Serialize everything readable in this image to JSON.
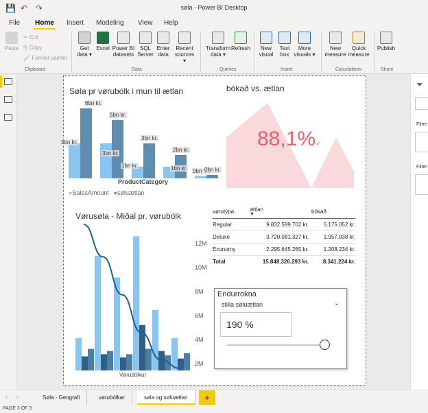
{
  "app": {
    "title": "søla - Power BI Desktop"
  },
  "ribbon_tabs": [
    "File",
    "Home",
    "Insert",
    "Modeling",
    "View",
    "Help"
  ],
  "active_tab": "Home",
  "ribbon": {
    "clipboard": {
      "paste": "Paste",
      "cut": "Cut",
      "copy": "Copy",
      "format_painter": "Format painter",
      "group": "Clipboard"
    },
    "data": {
      "get_data": "Get data ▾",
      "excel": "Excel",
      "pbi_datasets": "Power BI datasets",
      "sql": "SQL Server",
      "enter": "Enter data",
      "recent": "Recent sources ▾",
      "group": "Data"
    },
    "queries": {
      "transform": "Transform data ▾",
      "refresh": "Refresh",
      "group": "Queries"
    },
    "insert": {
      "new_visual": "New visual",
      "text_box": "Text box",
      "more_visuals": "More visuals ▾",
      "group": "Insert"
    },
    "calculations": {
      "new_measure": "New measure",
      "quick_measure": "Quick measure",
      "group": "Calculations"
    },
    "share": {
      "publish": "Publish",
      "group": "Share"
    }
  },
  "visual1": {
    "title": "Søla pr vørubólk i mun til ætlan",
    "xlabel": "ProductCategory",
    "legend": [
      "SalesAmount",
      "søluætlan"
    ],
    "labels": [
      "6bn kr.",
      "3bn kr.",
      "5bn kr.",
      "3bn kr.",
      "3bn kr.",
      "1bn kr.",
      "1bn kr.",
      "2bn kr.",
      "0bn kr.",
      "0bn kr."
    ]
  },
  "visual2": {
    "title": "bókað vs. ætlan",
    "value": "88,1%"
  },
  "visual3": {
    "title": "Vørusøla - Miðal pr. vørubólk",
    "xlabel": "Vørubólkur",
    "yticks": [
      "12M",
      "10M",
      "8M",
      "6M",
      "4M",
      "2M"
    ]
  },
  "matrix": {
    "headers": [
      "vørutýpa",
      "ætlan",
      "bókað"
    ],
    "rows": [
      [
        "Regular",
        "9.832.599.702 kr.",
        "5.175.052 kr."
      ],
      [
        "Deluxe",
        "3.720.081.327 kr.",
        "1.957.938 kr."
      ],
      [
        "Economy",
        "2.295.645.265 kr.",
        "1.208.234 kr."
      ]
    ],
    "total": [
      "Total",
      "15.848.326.293 kr.",
      "8.341.224 kr."
    ]
  },
  "slicer": {
    "title": "Endurrokna",
    "field": "stilla søluætlan",
    "value": "190 %"
  },
  "right_panel": {
    "filter_label_1": "Filter",
    "filter_label_2": "Filter"
  },
  "page_tabs": [
    "Søla - Geografi",
    "vørubólkar",
    "søla og søluætlan"
  ],
  "active_page": "søla og søluætlan",
  "status": "PAGE 3 OF 3",
  "chart_data": [
    {
      "type": "bar",
      "title": "Søla pr vørubólk i mun til ætlan",
      "xlabel": "ProductCategory",
      "series": [
        {
          "name": "SalesAmount",
          "values": [
            3,
            3,
            1,
            1,
            0.2
          ]
        },
        {
          "name": "søluætlan",
          "values": [
            6,
            5,
            3,
            2,
            0.3
          ]
        }
      ],
      "colors": [
        "#8cc4f0",
        "#5f8db0"
      ]
    },
    {
      "type": "bar",
      "title": "Vørusøla - Miðal pr. vørubólk",
      "xlabel": "Vørubólkur",
      "ylim": [
        0,
        13
      ],
      "series": [
        {
          "name": "",
          "values": [
            3.0,
            10.6,
            8.6,
            12.4,
            5.6,
            3.0
          ]
        },
        {
          "name": "",
          "values": [
            1.3,
            1.5,
            1.2,
            4.2,
            1.8,
            1.1
          ]
        },
        {
          "name": "",
          "values": [
            2.0,
            1.8,
            1.5,
            2.0,
            1.4,
            1.6
          ]
        }
      ],
      "line": [
        13.5,
        10.5,
        7.0,
        3.5,
        1.0,
        0.2
      ],
      "colors": [
        "#8cc4f0",
        "#2f5f82",
        "#4d7ea3",
        "#1f5c99"
      ]
    }
  ]
}
